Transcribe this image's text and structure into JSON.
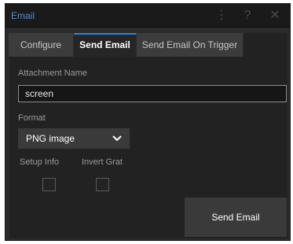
{
  "window": {
    "title": "Email"
  },
  "titlebar": {
    "more_icon": "more-vertical-icon",
    "help_icon": "help-icon",
    "close_icon": "close-icon",
    "more_glyph": "⋮",
    "help_glyph": "?",
    "close_glyph": "✕"
  },
  "tabs": [
    {
      "label": "Configure",
      "active": false
    },
    {
      "label": "Send Email",
      "active": true
    },
    {
      "label": "Send Email On Trigger",
      "active": false
    }
  ],
  "form": {
    "attachment_label": "Attachment Name",
    "attachment_value": "screen",
    "format_label": "Format",
    "format_selected": "PNG image",
    "setup_info_label": "Setup Info",
    "setup_info_checked": false,
    "invert_grat_label": "Invert Grat",
    "invert_grat_checked": false,
    "send_button_label": "Send Email"
  },
  "colors": {
    "accent": "#2f83d6",
    "title": "#4f8cd6",
    "background": "#2b2b2b"
  }
}
